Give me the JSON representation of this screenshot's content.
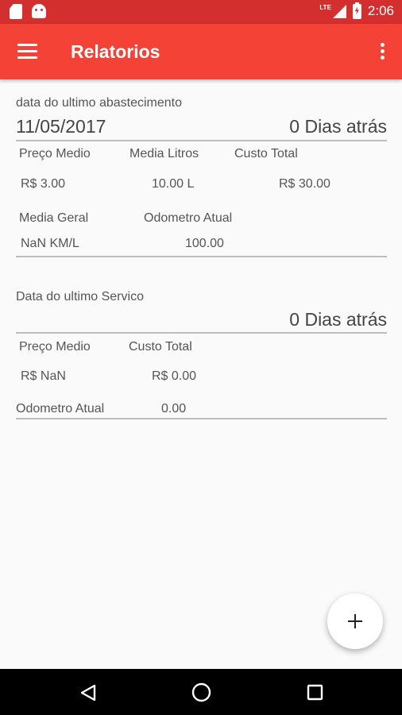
{
  "status_bar": {
    "network": "LTE",
    "time": "2:06"
  },
  "app_bar": {
    "title": "Relatorios",
    "menu_icon": "hamburger-menu-icon",
    "overflow_icon": "more-vert-icon"
  },
  "fuel": {
    "section_label": "data do ultimo abastecimento",
    "date": "11/05/2017",
    "days_ago": "0 Dias atrás",
    "avg_price_label": "Preço Medio",
    "avg_liters_label": "Media Litros",
    "total_cost_label": "Custo Total",
    "avg_price_value": "R$ 3.00",
    "avg_liters_value": "10.00 L",
    "total_cost_value": "R$ 30.00",
    "overall_avg_label": "Media Geral",
    "odometer_label": "Odometro Atual",
    "overall_avg_value": "NaN KM/L",
    "odometer_value": "100.00"
  },
  "service": {
    "section_label": "Data do ultimo Servico",
    "days_ago": "0 Dias atrás",
    "avg_price_label": "Preço Medio",
    "total_cost_label": "Custo Total",
    "avg_price_value": "R$ NaN",
    "total_cost_value": "R$ 0.00",
    "odometer_label": "Odometro Atual",
    "odometer_value": "0.00"
  },
  "fab": {
    "icon": "add-icon"
  },
  "colors": {
    "app_bar": "#f44336",
    "status_bar": "#d32f2f",
    "background": "#fafafa"
  }
}
